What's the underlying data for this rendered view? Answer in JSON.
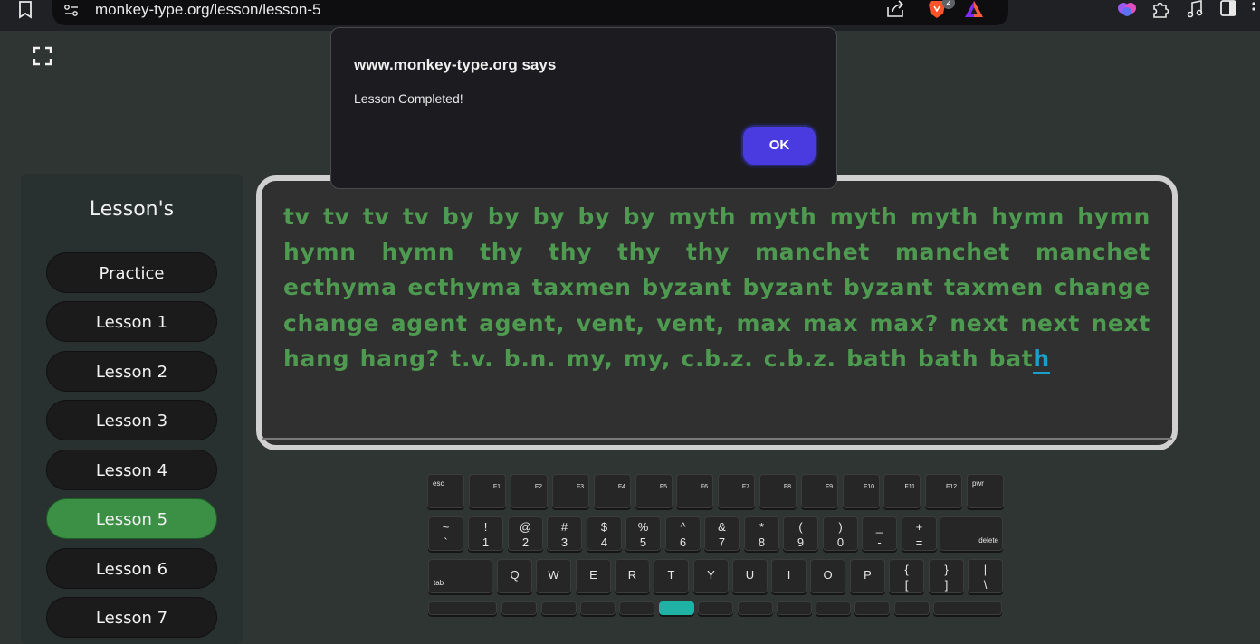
{
  "browser": {
    "url": "monkey-type.org/lesson/lesson-5",
    "brave_badge": "2",
    "icons": [
      "bookmark-icon",
      "site-info-icon",
      "share-icon",
      "brave-shields-icon",
      "brave-rewards-icon",
      "extension-brain-icon",
      "extensions-puzzle-icon",
      "media-controls-icon",
      "side-panel-icon"
    ]
  },
  "page": {
    "title": "Lesson-5",
    "fullscreen_icon": "fullscreen-icon"
  },
  "sidebar": {
    "title": "Lesson's",
    "items": [
      {
        "label": "Practice",
        "active": false
      },
      {
        "label": "Lesson 1",
        "active": false
      },
      {
        "label": "Lesson 2",
        "active": false
      },
      {
        "label": "Lesson 3",
        "active": false
      },
      {
        "label": "Lesson 4",
        "active": false
      },
      {
        "label": "Lesson 5",
        "active": true
      },
      {
        "label": "Lesson 6",
        "active": false
      },
      {
        "label": "Lesson 7",
        "active": false
      }
    ],
    "active_color": "#3c9045"
  },
  "typing": {
    "text_typed": "tv tv tv tv by by by by by myth myth myth myth hymn hymn hymn hymn thy thy thy thy manchet manchet manchet ecthyma ecthyma taxmen byzant byzant byzant taxmen change change agent agent, vent, vent, max max max? next next next hang hang? t.v. b.n. my, my, c.b.z. c.b.z. bath bath bat",
    "text_cursor": "h",
    "correct_color": "#4e9a50",
    "cursor_color": "#1aa0c8"
  },
  "keyboard": {
    "row_fn": [
      {
        "tl": "esc"
      },
      {
        "fn": "F1"
      },
      {
        "fn": "F2"
      },
      {
        "fn": "F3"
      },
      {
        "fn": "F4"
      },
      {
        "fn": "F5"
      },
      {
        "fn": "F6"
      },
      {
        "fn": "F7"
      },
      {
        "fn": "F8"
      },
      {
        "fn": "F9"
      },
      {
        "fn": "F10"
      },
      {
        "fn": "F11"
      },
      {
        "fn": "F12"
      },
      {
        "tl": "pwr"
      }
    ],
    "row_num": [
      {
        "top": "~",
        "bot": "`"
      },
      {
        "top": "!",
        "bot": "1"
      },
      {
        "top": "@",
        "bot": "2"
      },
      {
        "top": "#",
        "bot": "3"
      },
      {
        "top": "$",
        "bot": "4"
      },
      {
        "top": "%",
        "bot": "5"
      },
      {
        "top": "^",
        "bot": "6"
      },
      {
        "top": "&",
        "bot": "7"
      },
      {
        "top": "*",
        "bot": "8"
      },
      {
        "top": "(",
        "bot": "9"
      },
      {
        "top": ")",
        "bot": "0"
      },
      {
        "top": "_",
        "bot": "-"
      },
      {
        "top": "+",
        "bot": "="
      },
      {
        "br": "delete"
      }
    ],
    "row_top": [
      {
        "bl": "tab"
      },
      {
        "c": "Q"
      },
      {
        "c": "W"
      },
      {
        "c": "E"
      },
      {
        "c": "R"
      },
      {
        "c": "T"
      },
      {
        "c": "Y"
      },
      {
        "c": "U"
      },
      {
        "c": "I"
      },
      {
        "c": "O"
      },
      {
        "c": "P"
      },
      {
        "top": "{",
        "bot": "["
      },
      {
        "top": "}",
        "bot": "]"
      },
      {
        "top": "|",
        "bot": "\\"
      }
    ],
    "highlight_color": "#21b2a6"
  },
  "dialog": {
    "title": "www.monkey-type.org says",
    "message": "Lesson Completed!",
    "ok_label": "OK",
    "ok_color": "#4a3be0"
  }
}
